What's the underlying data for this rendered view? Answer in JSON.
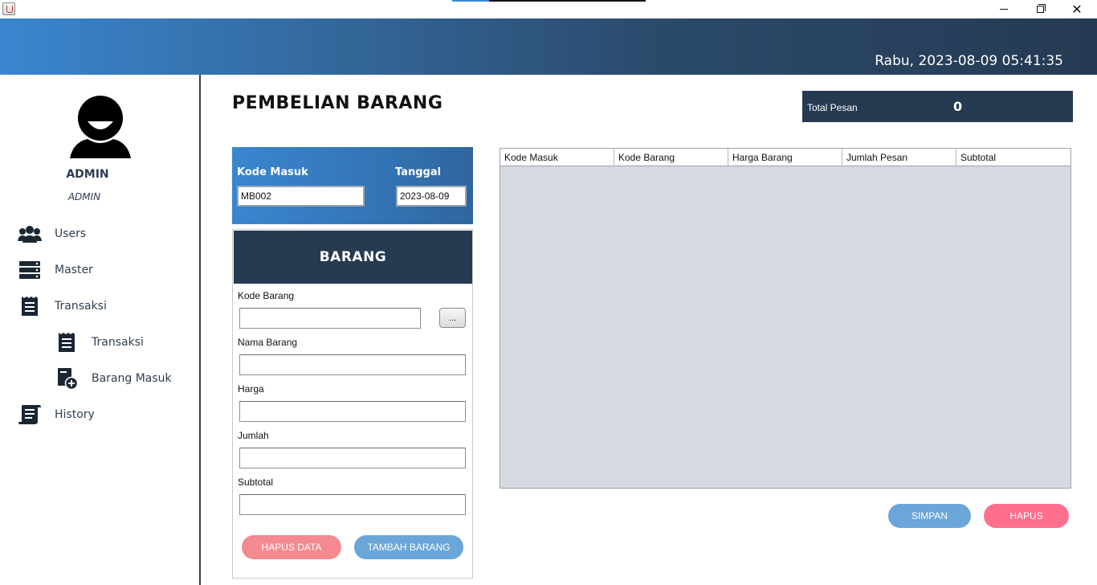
{
  "titlebar": {
    "app_icon": "java-cup-icon",
    "progress": 0.19,
    "minimize_icon": "minimize-icon",
    "maximize_icon": "restore-icon",
    "close_icon": "close-icon",
    "close_glyph": "✕"
  },
  "header": {
    "datetime": "Rabu, 2023-08-09 05:41:35",
    "gradient": [
      "#3a86cf",
      "#253a52"
    ]
  },
  "sidebar": {
    "avatar_icon": "user-avatar-icon",
    "user_name": "ADMIN",
    "user_role": "ADMIN",
    "items": [
      {
        "label": "Users",
        "icon": "users-icon"
      },
      {
        "label": "Master",
        "icon": "database-icon"
      },
      {
        "label": "Transaksi",
        "icon": "receipt-icon"
      },
      {
        "label": "Transaksi",
        "icon": "receipt-icon"
      },
      {
        "label": "Barang Masuk",
        "icon": "add-document-icon"
      },
      {
        "label": "History",
        "icon": "scroll-icon"
      }
    ]
  },
  "main": {
    "title": "PEMBELIAN BARANG",
    "total": {
      "label": "Total Pesan",
      "value": "0"
    },
    "kode_masuk": {
      "label": "Kode Masuk",
      "value": "MB002"
    },
    "tanggal": {
      "label": "Tanggal",
      "value": "2023-08-09"
    },
    "barang": {
      "title": "BARANG",
      "kode_barang_label": "Kode Barang",
      "browse_label": "...",
      "nama_barang_label": "Nama Barang",
      "harga_label": "Harga",
      "jumlah_label": "Jumlah",
      "subtotal_label": "Subtotal",
      "hapus_data_label": "HAPUS DATA",
      "tambah_barang_label": "TAMBAH BARANG"
    },
    "table": {
      "columns": [
        "Kode Masuk",
        "Kode Barang",
        "Harga Barang",
        "Jumlah Pesan",
        "Subtotal"
      ],
      "rows": []
    },
    "simpan_label": "SIMPAN",
    "hapus_label": "HAPUS"
  },
  "colors": {
    "accent_dark": "#263a52",
    "accent_blue": "#3a86cf",
    "button_blue": "#6aa6d8",
    "button_red": "#f48a8f",
    "button_pink": "#ff6f8c"
  }
}
